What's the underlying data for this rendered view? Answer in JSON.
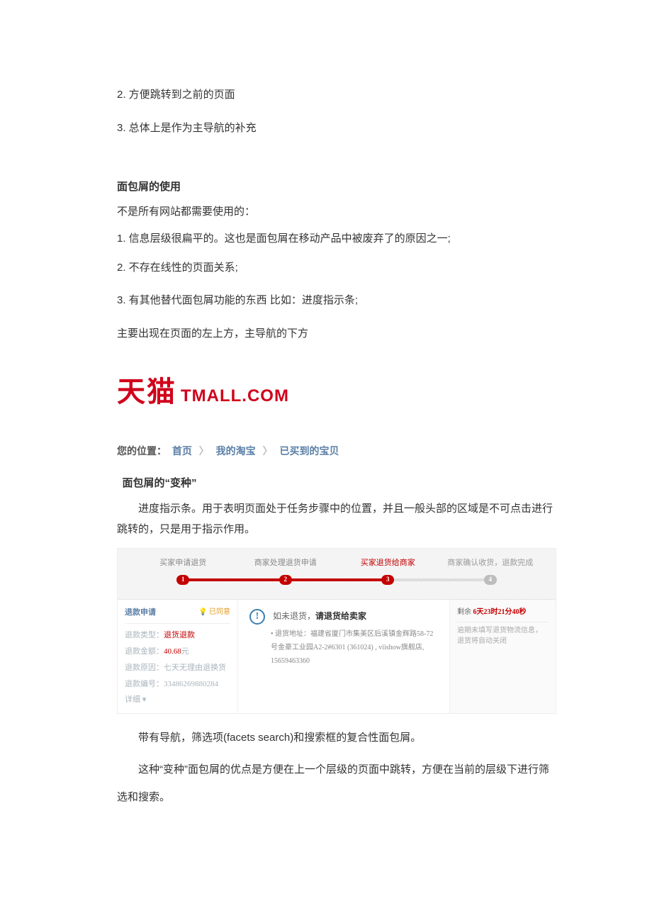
{
  "list1": {
    "i2": "2. 方便跳转到之前的页面",
    "i3": "3. 总体上是作为主导航的补充"
  },
  "section_use": {
    "heading": "面包屑的使用",
    "intro": "不是所有网站都需要使用的：",
    "i1": "1. 信息层级很扁平的。这也是面包屑在移动产品中被废弃了的原因之一;",
    "i2": "2. 不存在线性的页面关系;",
    "i3": "3. 有其他替代面包屑功能的东西 比如：进度指示条;",
    "pos": "主要出现在页面的左上方，主导航的下方"
  },
  "tmall": {
    "cn": "天猫",
    "en": "TMALL.COM"
  },
  "breadcrumb": {
    "prefix": "您的位置：",
    "l1": "首页",
    "l2": "我的淘宝",
    "l3": "已买到的宝贝",
    "sep": "〉"
  },
  "variant": {
    "heading": "面包屑的“变种”",
    "p1": "进度指示条。用于表明页面处于任务步骤中的位置，并且一般头部的区域是不可点击进行跳转的，只是用于指示作用。"
  },
  "progress": {
    "steps": {
      "s1": "买家申请退货",
      "s2": "商家处理退货申请",
      "s3": "买家退货给商家",
      "s4": "商家确认收货，退款完成",
      "n1": "1",
      "n2": "2",
      "n3": "3",
      "n4": "4"
    },
    "left": {
      "hdr": "退款申请",
      "tag": "💡 已同意",
      "k1": "退款类型：",
      "v1": "退货退款",
      "k2": "退款金额：",
      "v2": "40.68",
      "v2u": "元",
      "k3": "退款原因：",
      "v3": "七天无理由退换货",
      "k4": "退款编号：",
      "v4": "33486269880284",
      "more": "详细 ▾"
    },
    "mid": {
      "pre": "如未退货，",
      "bold": "请退货给卖家",
      "addr_label": "• 退货地址：",
      "addr": "福建省厦门市集美区后溪镇金辉路58-72号金豪工业园A2-2#6301 (361024) , viishow旗舰店, 15659463360"
    },
    "right": {
      "time_pre": "剩余 ",
      "time_val": "6天23时21分40秒",
      "note": "逾期未填写退货物流信息，退货将自动关闭"
    }
  },
  "tail": {
    "p1": "带有导航，筛选项(facets search)和搜索框的复合性面包屑。",
    "p2": "这种“变种”面包屑的优点是方便在上一个层级的页面中跳转，方便在当前的层级下进行筛选和搜索。"
  }
}
